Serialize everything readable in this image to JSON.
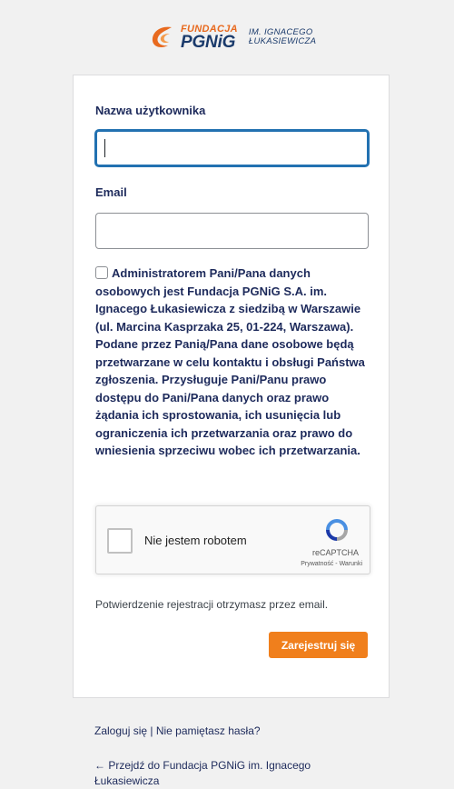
{
  "logo": {
    "line1": "FUNDACJA",
    "line2": "PGNiG",
    "sub1": "IM. IGNACEGO",
    "sub2": "ŁUKASIEWICZA"
  },
  "form": {
    "username_label": "Nazwa użytkownika",
    "username_value": "",
    "email_label": "Email",
    "email_value": "",
    "consent_text": "Administratorem Pani/Pana danych osobowych jest Fundacja PGNiG S.A. im. Ignacego Łukasiewicza z siedzibą w Warszawie (ul. Marcina Kasprzaka 25, 01-224, Warszawa). Podane przez Panią/Pana dane osobowe będą przetwarzane w celu kontaktu i obsługi Państwa zgłoszenia. Przysługuje Pani/Panu prawo dostępu do Pani/Pana danych oraz prawo żądania ich sprostowania, ich usunięcia lub ograniczenia ich przetwarzania oraz prawo do wniesienia sprzeciwu wobec ich przetwarzania.",
    "consent_checked": false,
    "recaptcha": {
      "label": "Nie jestem robotem",
      "brand": "reCAPTCHA",
      "links": "Prywatność - Warunki"
    },
    "notice": "Potwierdzenie rejestracji otrzymasz przez email.",
    "submit_label": "Zarejestruj się"
  },
  "nav": {
    "login": "Zaloguj się",
    "separator": " | ",
    "forgot": "Nie pamiętasz hasła?",
    "back": "← Przejdź do Fundacja PGNiG im. Ignacego Łukasiewicza"
  },
  "colors": {
    "accent": "#f07f1c",
    "brand_blue": "#1d2a5b",
    "focus": "#2271b1",
    "background": "#f1f1f1"
  }
}
